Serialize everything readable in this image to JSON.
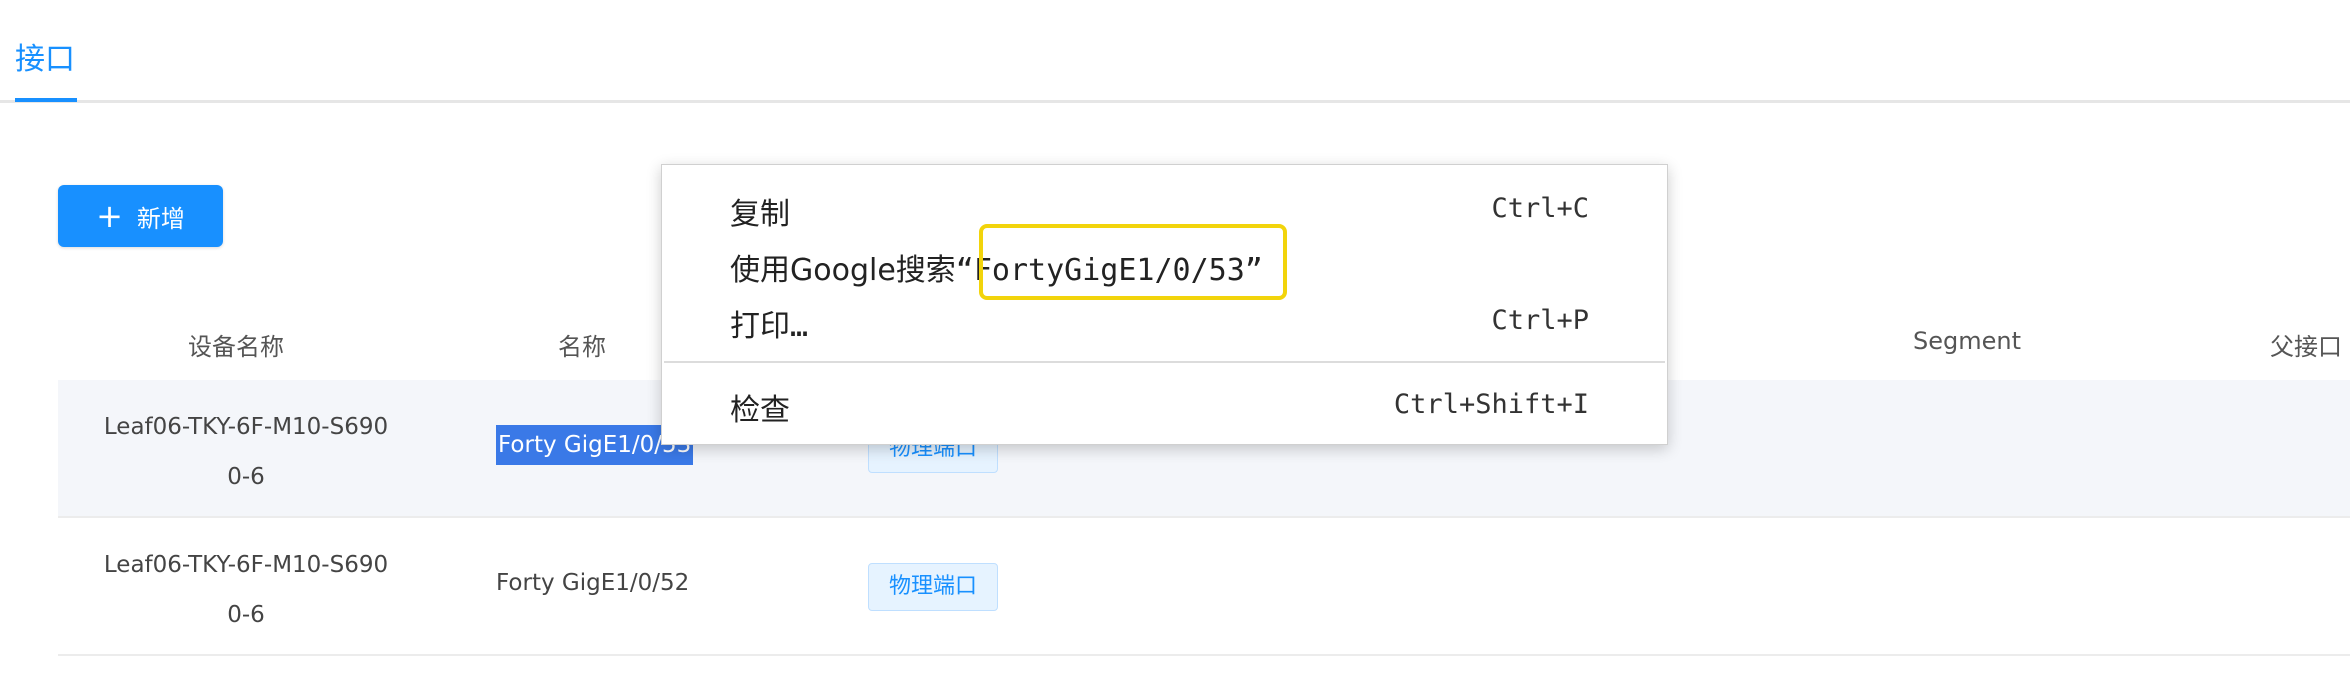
{
  "tabs": [
    {
      "label": "接口",
      "active": true
    }
  ],
  "toolbar": {
    "add_label": "新增",
    "add_icon": "plus-icon"
  },
  "table": {
    "columns": [
      "设备名称",
      "名称",
      "Segment",
      "父接口"
    ],
    "rows": [
      {
        "device_line1": "Leaf06-TKY-6F-M10-S690",
        "device_line2": "0-6",
        "name": "Forty GigE1/0/53",
        "name_visible": "Forty GigE1/0/53",
        "type": "物理端口",
        "selected": true
      },
      {
        "device_line1": "Leaf06-TKY-6F-M10-S690",
        "device_line2": "0-6",
        "name": "Forty GigE1/0/52",
        "type": "物理端口",
        "selected": false
      }
    ]
  },
  "context_menu": {
    "items": [
      {
        "label": "复制",
        "shortcut": "Ctrl+C"
      },
      {
        "label_prefix": "使用Google搜索",
        "label_term": "“FortyGigE1/0/53”",
        "shortcut": ""
      },
      {
        "label": "打印…",
        "shortcut": "Ctrl+P"
      },
      {
        "label": "检查",
        "shortcut": "Ctrl+Shift+I"
      }
    ]
  },
  "colors": {
    "accent": "#1890ff",
    "selection": "#3a79e7",
    "highlight_box": "#f2d40b",
    "tag_bg": "#e6f3ff"
  }
}
